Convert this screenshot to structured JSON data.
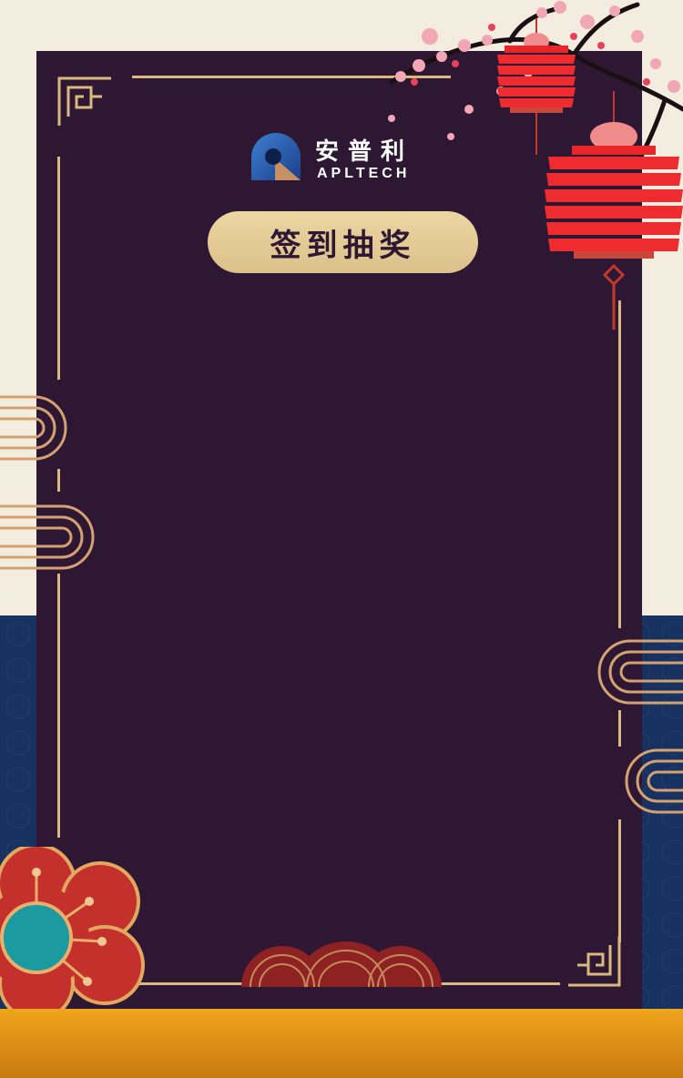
{
  "brand": {
    "name_cn": "安普利",
    "name_en": "APLTECH",
    "logo_icon": "apltech-logo-icon"
  },
  "button": {
    "label": "签到抽奖"
  },
  "colors": {
    "panel": "#2d1733",
    "gold_line": "#d9b980",
    "pill": "#e6cc96",
    "cream_bg": "#f3ede0",
    "navy_bg": "#173260",
    "footer_gold": "#f0a51d",
    "lantern_red": "#e8262a",
    "flower_red": "#c4302b",
    "flower_teal": "#1b9aa0"
  },
  "icons": [
    "corner-knot-icon",
    "lantern-icon",
    "plum-blossom-icon",
    "cloud-wave-icon",
    "flower-icon"
  ]
}
